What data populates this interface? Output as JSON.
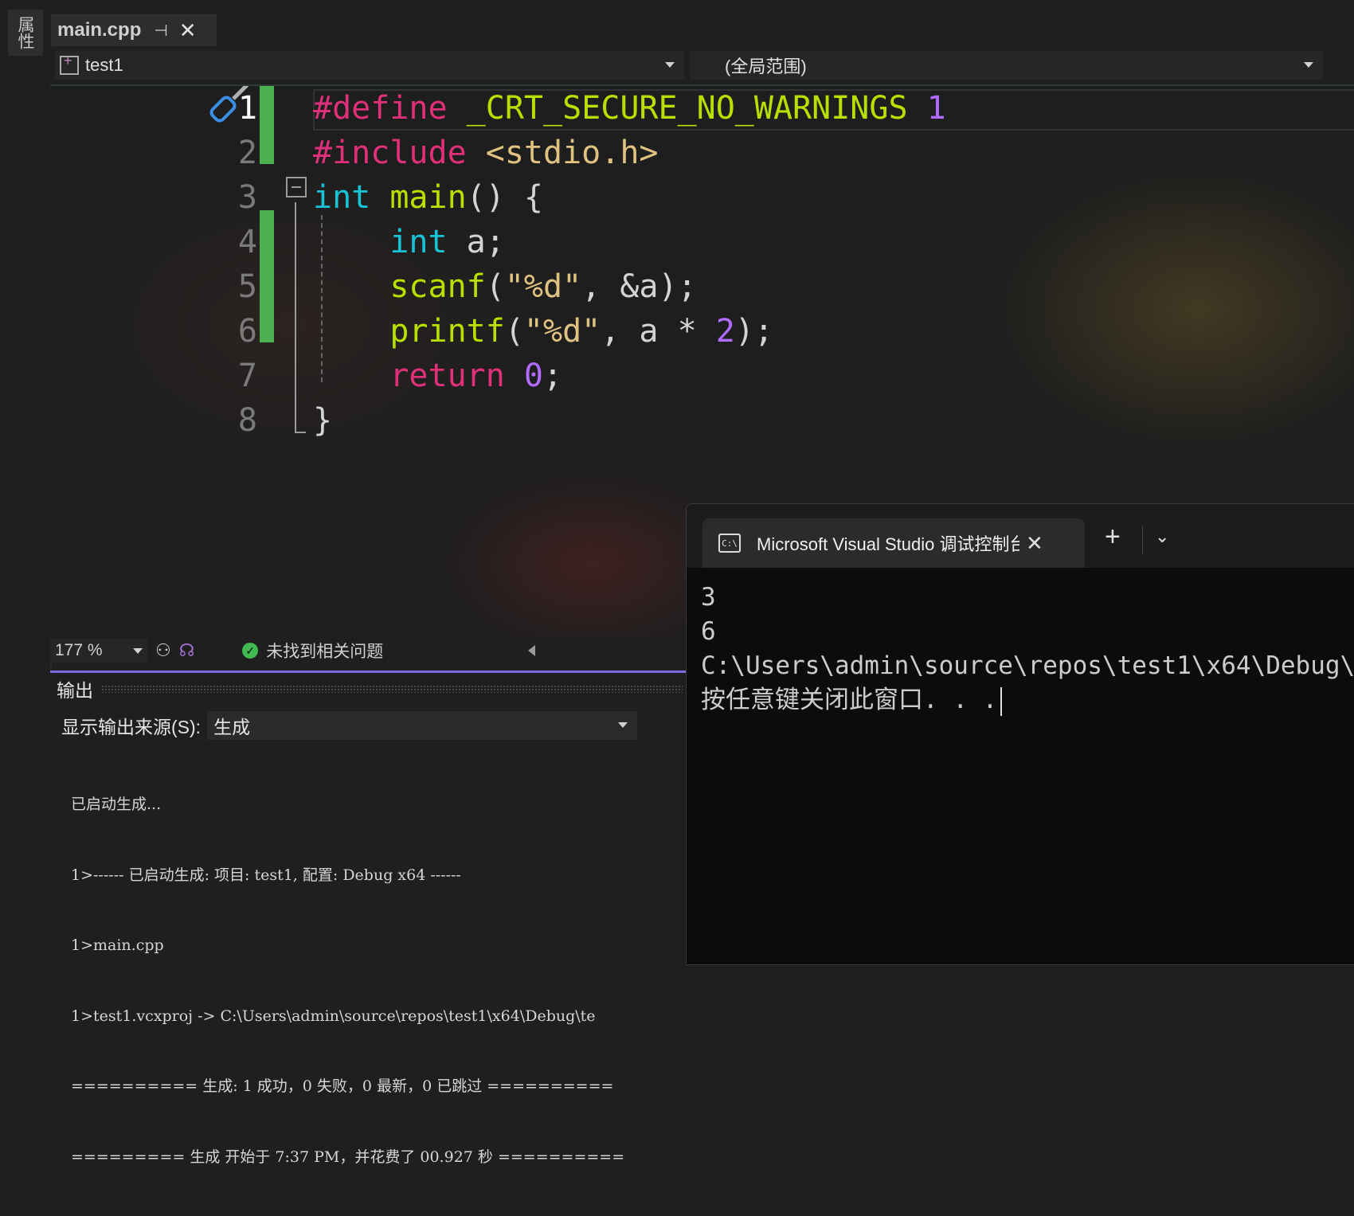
{
  "sidebar": {
    "label": "属性"
  },
  "tab": {
    "filename": "main.cpp",
    "pin": "⊣",
    "close": "✕"
  },
  "nav": {
    "project": "test1",
    "scope": "(全局范围)"
  },
  "code": {
    "line_numbers": [
      "1",
      "2",
      "3",
      "4",
      "5",
      "6",
      "7",
      "8"
    ],
    "lines": [
      [
        [
          "kw-pink",
          "#define "
        ],
        [
          "fn",
          "_CRT_SECURE_NO_WARNINGS "
        ],
        [
          "num",
          "1"
        ]
      ],
      [
        [
          "kw-pink",
          "#include "
        ],
        [
          "hdr",
          "<stdio.h>"
        ]
      ],
      [
        [
          "kw-cyan",
          "int "
        ],
        [
          "fn",
          "main"
        ],
        [
          "",
          "() {"
        ]
      ],
      [
        [
          "",
          "    "
        ],
        [
          "kw-cyan",
          "int "
        ],
        [
          "",
          "a;"
        ]
      ],
      [
        [
          "",
          "    "
        ],
        [
          "fn",
          "scanf"
        ],
        [
          "",
          "("
        ],
        [
          "str",
          "\"%d\""
        ],
        [
          "",
          ", &a);"
        ]
      ],
      [
        [
          "",
          "    "
        ],
        [
          "fn",
          "printf"
        ],
        [
          "",
          "("
        ],
        [
          "str",
          "\"%d\""
        ],
        [
          "",
          ", a * "
        ],
        [
          "num",
          "2"
        ],
        [
          "",
          ");"
        ]
      ],
      [
        [
          "",
          "    "
        ],
        [
          "kw-pink",
          "return "
        ],
        [
          "num",
          "0"
        ],
        [
          "",
          ";"
        ]
      ],
      [
        [
          "",
          "}"
        ]
      ]
    ]
  },
  "status": {
    "zoom": "177 %",
    "issues": "未找到相关问题"
  },
  "output": {
    "title": "输出",
    "source_label": "显示输出来源(S):",
    "source_value": "生成",
    "lines": [
      "已启动生成...",
      "1>------ 已启动生成: 项目: test1, 配置: Debug x64 ------",
      "1>main.cpp",
      "1>test1.vcxproj -> C:\\Users\\admin\\source\\repos\\test1\\x64\\Debug\\te",
      "========== 生成: 1 成功，0 失败，0 最新，0 已跳过 ==========",
      "========= 生成 开始于 7:37 PM，并花费了 00.927 秒 =========="
    ]
  },
  "terminal": {
    "icon_text": "C:\\",
    "tab_title": "Microsoft Visual Studio 调试控制台",
    "close": "✕",
    "new_tab": "+",
    "dropdown": "⌄",
    "lines": [
      "3",
      "6",
      "C:\\Users\\admin\\source\\repos\\test1\\x64\\Debug\\",
      "按任意键关闭此窗口. . ."
    ]
  }
}
